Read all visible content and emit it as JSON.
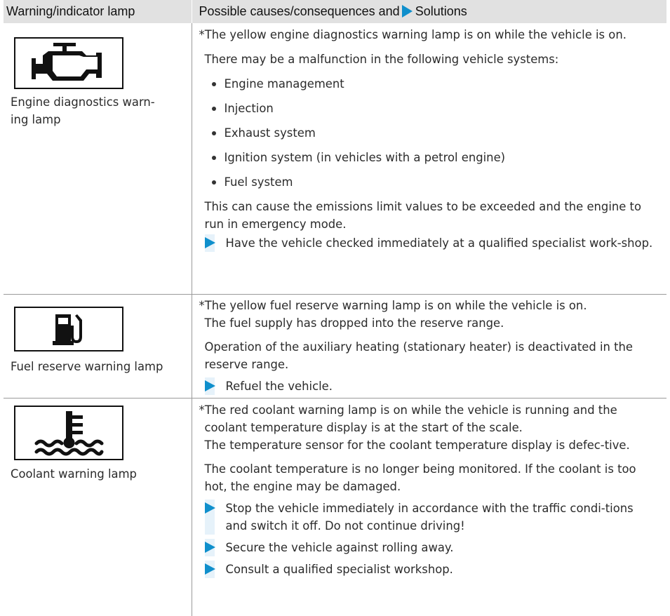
{
  "header": {
    "col1": "Warning/indicator lamp",
    "col2_prefix": "Possible causes/consequences and",
    "col2_suffix": "Solutions"
  },
  "rows": [
    {
      "icon": "engine-diagnostics-icon",
      "label": "Engine diagnostics warn-ing lamp",
      "label_line1": "Engine diagnostics warn-",
      "label_line2": "ing lamp",
      "intro": "*The yellow engine diagnostics warning lamp is on while the vehicle is on.",
      "p1": "There may be a malfunction in the following vehicle systems:",
      "bullets": [
        "Engine management",
        "Injection",
        "Exhaust system",
        "Ignition system (in vehicles with a petrol engine)",
        "Fuel system"
      ],
      "p2": "This can cause the emissions limit values to be exceeded and the engine to run in emergency mode.",
      "actions": [
        "Have the vehicle checked immediately at a qualified specialist work-shop."
      ]
    },
    {
      "icon": "fuel-pump-icon",
      "label": "Fuel reserve warning lamp",
      "intro": "*The yellow fuel reserve warning lamp is on while the vehicle is on.",
      "intro2": "The fuel supply has dropped into the reserve range.",
      "p1": "Operation of the auxiliary heating (stationary heater) is deactivated in the reserve range.",
      "actions": [
        "Refuel the vehicle."
      ]
    },
    {
      "icon": "coolant-temperature-icon",
      "label": "Coolant warning lamp",
      "intro": "*The red coolant warning lamp is on while the vehicle is running and the coolant temperature display is at the start of the scale.",
      "intro2": "The temperature sensor for the coolant temperature display is defec-tive.",
      "p1": "The coolant temperature is no longer being monitored. If the coolant is too hot, the engine may be damaged.",
      "actions": [
        "Stop the vehicle immediately in accordance with the traffic condi-tions and switch it off. Do not continue driving!",
        "Secure the vehicle against rolling away.",
        "Consult a qualified specialist workshop."
      ]
    }
  ],
  "colors": {
    "header_bg": "#e1e1e1",
    "accent": "#0f8fcc",
    "action_bar": "#e6f2fa"
  }
}
